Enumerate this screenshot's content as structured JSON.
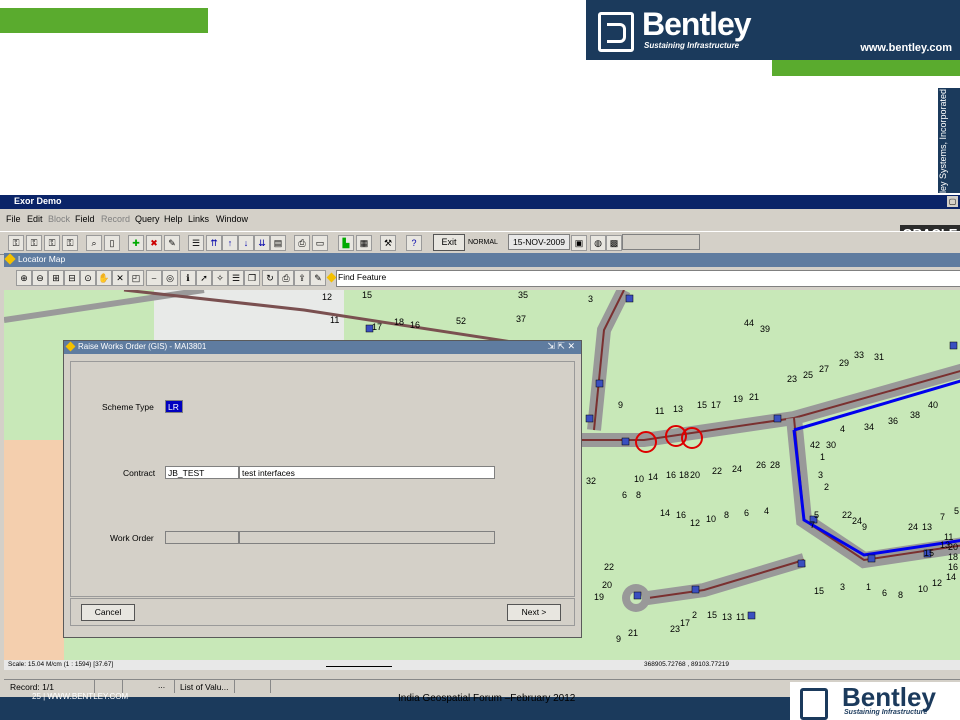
{
  "slide": {
    "logo_text": "Bentley",
    "logo_tagline": "Sustaining Infrastructure",
    "logo_url": "www.bentley.com",
    "side_copyright": "ley Systems, Incorporated",
    "footer_left": "25 | WWW.BENTLEY.COM",
    "footer_center": "India Geospatial Forum –February 2012",
    "footer_logo_text": "Bentley",
    "footer_logo_tagline": "Sustaining Infrastructure",
    "brand_green": "#5aab2e",
    "brand_navy": "#1b3a5c"
  },
  "app": {
    "title": "Exor Demo",
    "menu": [
      "File",
      "Edit",
      "Block",
      "Field",
      "Record",
      "Query",
      "Help",
      "Links",
      "Window"
    ],
    "menu_disabled": [
      "Block",
      "Record"
    ],
    "oracle_logo": "ORACLE",
    "toolbar": {
      "exit_label": "Exit",
      "mode_label": "NORMAL",
      "date_value": "15-NOV-2009"
    }
  },
  "locator": {
    "title": "Locator Map",
    "find_feature_label": "Find Feature",
    "scale_text": "Scale: 15.04 M/cm (1 : 1594) [37.67]",
    "coords_text": "368905.72768 , 89103.77219"
  },
  "record_bar": {
    "record_text": "Record: 1/1",
    "ellipsis": "...",
    "lov_text": "List of Valu..."
  },
  "dialog": {
    "title": "Raise Works Order (GIS) - MAI3801",
    "scheme_type_label": "Scheme Type",
    "scheme_type_value": "LR",
    "contract_label": "Contract",
    "contract_code": "JB_TEST",
    "contract_description": "test interfaces",
    "work_order_label": "Work Order",
    "cancel_label": "Cancel",
    "next_label": "Next >"
  },
  "map_labels": [
    "12",
    "15",
    "11",
    "17",
    "18",
    "16",
    "52",
    "37",
    "35",
    "3",
    "44",
    "39",
    "31",
    "33",
    "29",
    "27",
    "25",
    "23",
    "21",
    "19",
    "17",
    "15",
    "13",
    "11",
    "9",
    "6",
    "8",
    "7",
    "5",
    "3",
    "1",
    "2",
    "4",
    "34",
    "36",
    "38",
    "40",
    "42",
    "30",
    "32",
    "10",
    "14",
    "16",
    "18",
    "20",
    "22",
    "24",
    "26",
    "28",
    "14",
    "16",
    "12",
    "10",
    "8",
    "6",
    "4",
    "2",
    "15",
    "13",
    "11",
    "9",
    "21",
    "23",
    "17",
    "19",
    "20",
    "22",
    "24",
    "13",
    "15",
    "3",
    "1",
    "6",
    "8",
    "10",
    "12",
    "14",
    "16",
    "18",
    "20",
    "22",
    "24",
    "9",
    "7",
    "5",
    "11",
    "13",
    "15",
    "17",
    "19"
  ]
}
